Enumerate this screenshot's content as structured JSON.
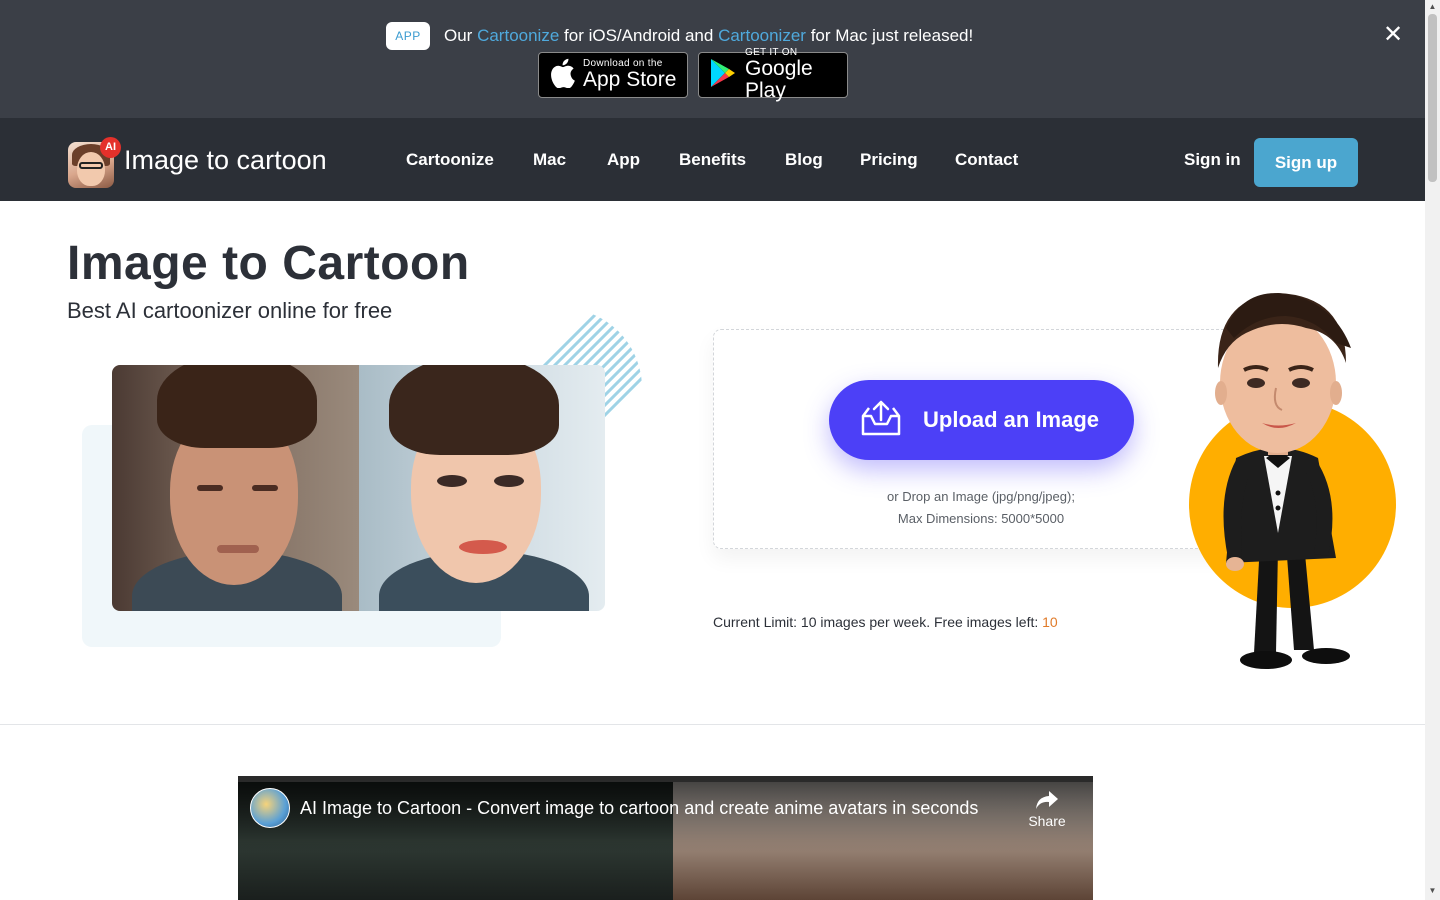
{
  "banner": {
    "badge": "APP",
    "text_1": "Our",
    "link_1": "Cartoonize",
    "text_2": "for iOS/Android and",
    "link_2": "Cartoonizer",
    "text_3": "for Mac just released!",
    "app_store_small": "Download on the",
    "app_store_big": "App Store",
    "google_small": "GET IT ON",
    "google_big": "Google Play",
    "close_icon": "close-icon"
  },
  "nav": {
    "logo_text": "Image to cartoon",
    "ai_badge": "AI",
    "links": [
      "Cartoonize",
      "Mac",
      "App",
      "Benefits",
      "Blog",
      "Pricing",
      "Contact"
    ],
    "sign_in": "Sign in",
    "sign_up": "Sign up"
  },
  "hero": {
    "title": "Image to Cartoon",
    "subtitle": "Best AI cartoonizer online for free"
  },
  "upload": {
    "button_label": "Upload an Image",
    "hint_line1": "or Drop an Image (jpg/png/jpeg);",
    "hint_line2": "Max Dimensions: 5000*5000",
    "limit_text": "Current Limit: 10 images per week. Free images left:",
    "limit_left": "10"
  },
  "video": {
    "title": "AI Image to Cartoon - Convert image to cartoon and create anime avatars in seconds",
    "share": "Share"
  },
  "colors": {
    "banner_bg": "#3b3f47",
    "nav_bg": "#2b2f36",
    "accent_blue": "#4ba6cf",
    "upload_button": "#4c40f7",
    "circle_orange": "#ffae00",
    "limit_orange": "#e07b2a"
  }
}
